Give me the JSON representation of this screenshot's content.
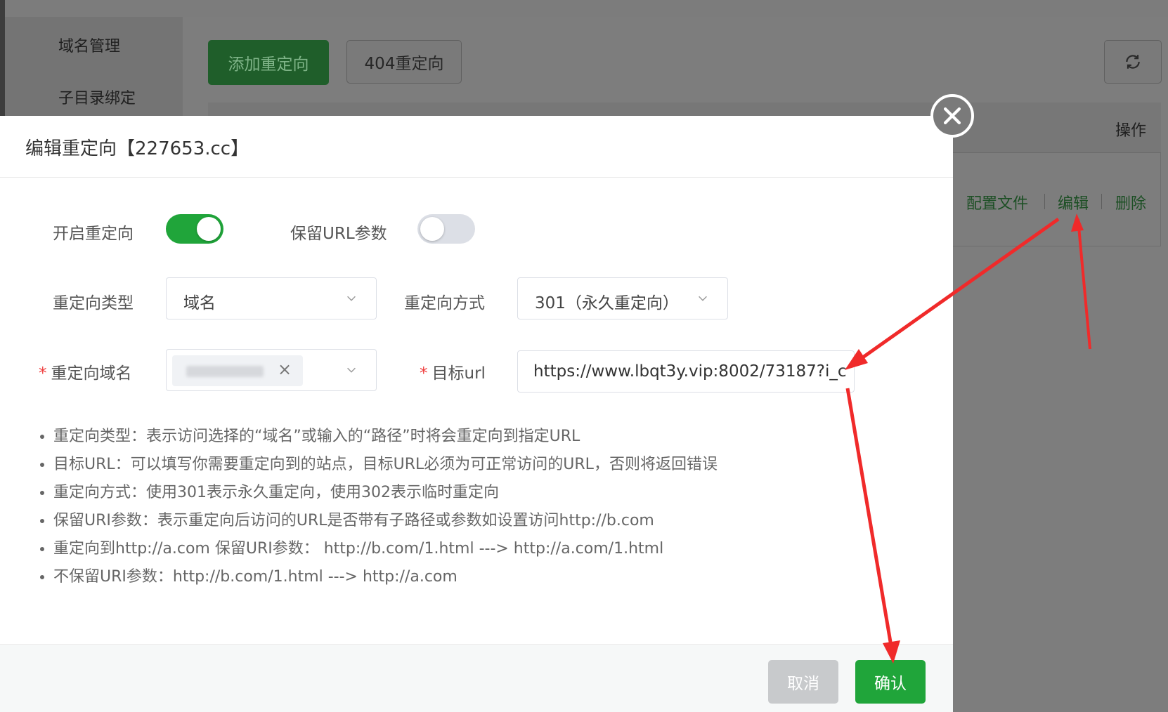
{
  "background": {
    "sidebar": {
      "items": [
        "域名管理",
        "子目录绑定"
      ]
    },
    "toolbar": {
      "add_redirect_label": "添加重定向",
      "redirect_404_label": "404重定向",
      "refresh_icon": "refresh-icon"
    },
    "table": {
      "operation_header": "操作",
      "row_actions": [
        "配置文件",
        "编辑",
        "删除"
      ]
    }
  },
  "modal": {
    "title": "编辑重定向【227653.cc】",
    "enable_redirect": {
      "label": "开启重定向",
      "on": true
    },
    "keep_url_params": {
      "label": "保留URL参数",
      "on": false
    },
    "redirect_type": {
      "label": "重定向类型",
      "value": "域名"
    },
    "redirect_method": {
      "label": "重定向方式",
      "value": "301（永久重定向）"
    },
    "redirect_domain": {
      "required_mark": "*",
      "label": "重定向域名"
    },
    "target_url": {
      "required_mark": "*",
      "label": "目标url",
      "value": "https://www.lbqt3y.vip:8002/73187?i_c"
    },
    "tips": [
      "重定向类型：表示访问选择的“域名”或输入的“路径”时将会重定向到指定URL",
      "目标URL：可以填写你需要重定向到的站点，目标URL必须为可正常访问的URL，否则将返回错误",
      "重定向方式：使用301表示永久重定向，使用302表示临时重定向",
      "保留URI参数：表示重定向后访问的URL是否带有子路径或参数如设置访问http://b.com",
      "重定向到http://a.com 保留URI参数：  http://b.com/1.html ---> http://a.com/1.html",
      "不保留URI参数：http://b.com/1.html ---> http://a.com"
    ],
    "cancel_label": "取消",
    "confirm_label": "确认"
  },
  "colors": {
    "accent_green": "#20a53a",
    "annotation_red": "#f02a2a"
  }
}
